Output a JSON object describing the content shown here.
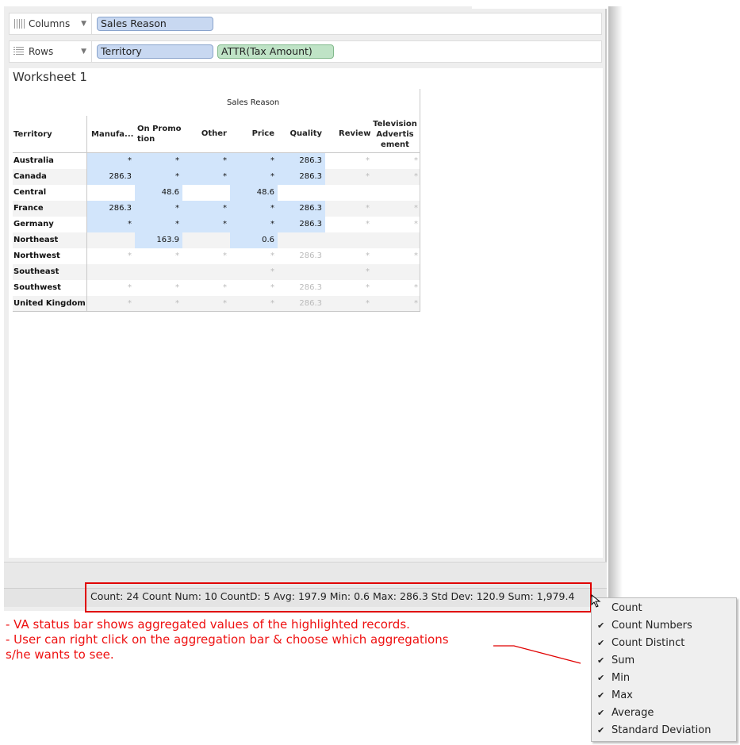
{
  "shelves": {
    "columns": {
      "label": "Columns",
      "pills": [
        "Sales Reason"
      ]
    },
    "rows": {
      "label": "Rows",
      "pills": [
        "Territory",
        "ATTR(Tax Amount)"
      ]
    }
  },
  "worksheet": {
    "title": "Worksheet 1",
    "crosstab": {
      "column_group_header": "Sales Reason",
      "row_header": "Territory",
      "columns": [
        "Manufa...",
        "On Promo\ntion",
        "Other",
        "Price",
        "Quality",
        "Review",
        "Television\nAdvertis\nement"
      ],
      "rows": [
        {
          "territory": "Australia",
          "values": [
            "*",
            "*",
            "*",
            "*",
            "286.3",
            "*",
            "*"
          ]
        },
        {
          "territory": "Canada",
          "values": [
            "286.3",
            "*",
            "*",
            "*",
            "286.3",
            "*",
            "*"
          ]
        },
        {
          "territory": "Central",
          "values": [
            "",
            "48.6",
            "",
            "48.6",
            "",
            "",
            ""
          ]
        },
        {
          "territory": "France",
          "values": [
            "286.3",
            "*",
            "*",
            "*",
            "286.3",
            "*",
            "*"
          ]
        },
        {
          "territory": "Germany",
          "values": [
            "*",
            "*",
            "*",
            "*",
            "286.3",
            "*",
            "*"
          ]
        },
        {
          "territory": "Northeast",
          "values": [
            "",
            "163.9",
            "",
            "0.6",
            "",
            "",
            ""
          ]
        },
        {
          "territory": "Northwest",
          "values": [
            "*",
            "*",
            "*",
            "*",
            "286.3",
            "*",
            "*"
          ]
        },
        {
          "territory": "Southeast",
          "values": [
            "",
            "",
            "",
            "*",
            "",
            "*",
            ""
          ]
        },
        {
          "territory": "Southwest",
          "values": [
            "*",
            "*",
            "*",
            "*",
            "286.3",
            "*",
            "*"
          ]
        },
        {
          "territory": "United Kingdom",
          "values": [
            "*",
            "*",
            "*",
            "*",
            "286.3",
            "*",
            "*"
          ]
        }
      ]
    }
  },
  "status_bar": {
    "text": "Count: 24  Count Num: 10  CountD: 5  Avg: 197.9  Min: 0.6  Max: 286.3  Std Dev: 120.9  Sum: 1,979.4"
  },
  "annotation": {
    "lines": [
      "- VA status bar shows aggregated values of the highlighted records.",
      "- User can right click on the aggregation bar & choose which aggregations",
      " s/he wants to see."
    ],
    "color": "#ee1111"
  },
  "context_menu": {
    "items": [
      {
        "label": "Count",
        "checked": false
      },
      {
        "label": "Count Numbers",
        "checked": true
      },
      {
        "label": "Count Distinct",
        "checked": true
      },
      {
        "label": "Sum",
        "checked": true
      },
      {
        "label": "Min",
        "checked": true
      },
      {
        "label": "Max",
        "checked": true
      },
      {
        "label": "Average",
        "checked": true
      },
      {
        "label": "Standard Deviation",
        "checked": true
      }
    ]
  },
  "colors": {
    "highlight": "#d2e5fb",
    "dimension_pill": "#c8d8f1",
    "measure_pill": "#bfe3c6",
    "callout": "#e00000"
  }
}
